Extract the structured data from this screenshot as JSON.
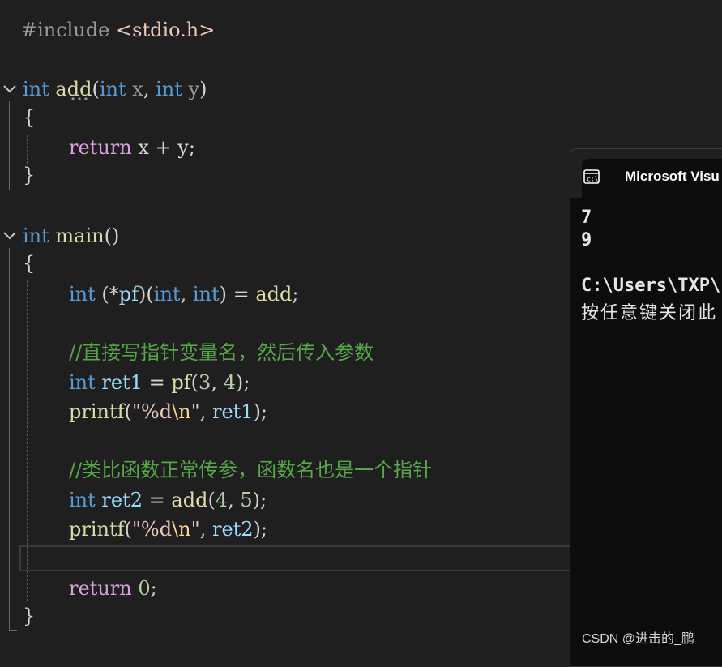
{
  "code": {
    "l1": {
      "directive": "#include",
      "header": "<stdio.h>"
    },
    "l2": {
      "t1": "int",
      "fn": "add",
      "p1": "(",
      "t2": "int",
      "a": "x",
      "c": ",",
      "t3": "int",
      "b": "y",
      "p2": ")"
    },
    "l3": {
      "brace": "{"
    },
    "l4": {
      "kw": "return",
      "expr": "x + y;"
    },
    "l5": {
      "brace": "}"
    },
    "l6": {
      "t": "int",
      "fn": "main",
      "p": "()"
    },
    "l7": {
      "brace": "{"
    },
    "l8": {
      "t1": "int",
      "o": "(*",
      "v": "pf",
      "m": ")(",
      "t2": "int",
      "c": ",",
      "t3": "int",
      "e": ") =",
      "fn": "add",
      "s": ";"
    },
    "l9": {
      "comment": "//直接写指针变量名，然后传入参数"
    },
    "l10": {
      "t": "int",
      "v": "ret1",
      "eq": "=",
      "fn": "pf",
      "o": "(",
      "n1": "3",
      "c": ",",
      "n2": "4",
      "e": ");"
    },
    "l11": {
      "fn": "printf",
      "o": "(",
      "q1": "\"%d",
      "esc": "\\n",
      "q2": "\"",
      "c": ",",
      "v": "ret1",
      "e": ");"
    },
    "l12": {
      "comment": "//类比函数正常传参，函数名也是一个指针"
    },
    "l13": {
      "t": "int",
      "v": "ret2",
      "eq": "=",
      "fn": "add",
      "o": "(",
      "n1": "4",
      "c": ",",
      "n2": "5",
      "e": ");"
    },
    "l14": {
      "fn": "printf",
      "o": "(",
      "q1": "\"%d",
      "esc": "\\n",
      "q2": "\"",
      "c": ",",
      "v": "ret2",
      "e": ");"
    },
    "l15": {
      "kw": "return",
      "n": "0",
      "s": ";"
    },
    "l16": {
      "brace": "}"
    }
  },
  "console": {
    "title": "Microsoft Visu",
    "output": [
      "7",
      "9",
      "",
      "C:\\Users\\TXP\\",
      "按任意键关闭此"
    ]
  },
  "watermark": "CSDN @进击的_鹏",
  "colors": {
    "background": "#1f1f1f",
    "keyword": "#569cd6",
    "control_keyword": "#d8a0df",
    "function": "#dcdcaa",
    "variable": "#9cdcfe",
    "number": "#b5cea8",
    "string": "#e8c9bb",
    "comment": "#57a64a",
    "console_bg": "#0c0c0c"
  }
}
